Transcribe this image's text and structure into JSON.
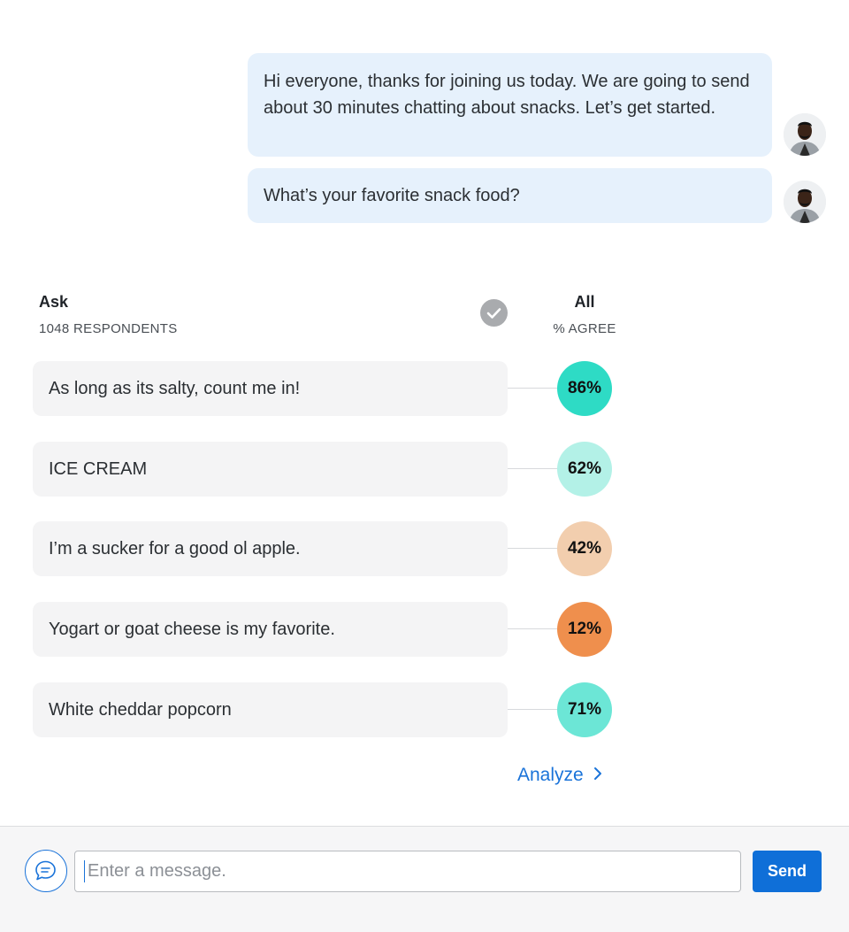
{
  "messages": [
    {
      "text": "Hi everyone, thanks for joining us today. We are going to send about 30 minutes chatting about snacks. Let’s get started.",
      "avatar": "avatar-man-icon"
    },
    {
      "text": "What’s your favorite snack food?",
      "avatar": "avatar-man-icon"
    }
  ],
  "poll": {
    "title": "Ask",
    "respondents": "1048 RESPONDENTS",
    "check_icon": "checkmark-icon",
    "column_title": "All",
    "column_sub": "% AGREE",
    "rows": [
      {
        "text": "As long as its salty, count me in!",
        "pct": "86%",
        "value": 86,
        "color": "#2edbc5"
      },
      {
        "text": "ICE CREAM",
        "pct": "62%",
        "value": 62,
        "color": "#b3f1e7"
      },
      {
        "text": "I’m a sucker for a good ol apple.",
        "pct": "42%",
        "value": 42,
        "color": "#f2ceae"
      },
      {
        "text": "Yogart or goat cheese is my favorite.",
        "pct": "12%",
        "value": 12,
        "color": "#ef8f4d"
      },
      {
        "text": "White cheddar popcorn",
        "pct": "71%",
        "value": 71,
        "color": "#6ce6d6"
      }
    ],
    "analyze_label": "Analyze",
    "analyze_icon": "chevron-right-icon"
  },
  "composer": {
    "chat_icon": "chat-bubble-icon",
    "placeholder": "Enter a message.",
    "value": "",
    "send_label": "Send"
  },
  "colors": {
    "accent": "#0f6fd8",
    "bubble": "#e6f1fc",
    "answer_bg": "#f4f4f5"
  }
}
